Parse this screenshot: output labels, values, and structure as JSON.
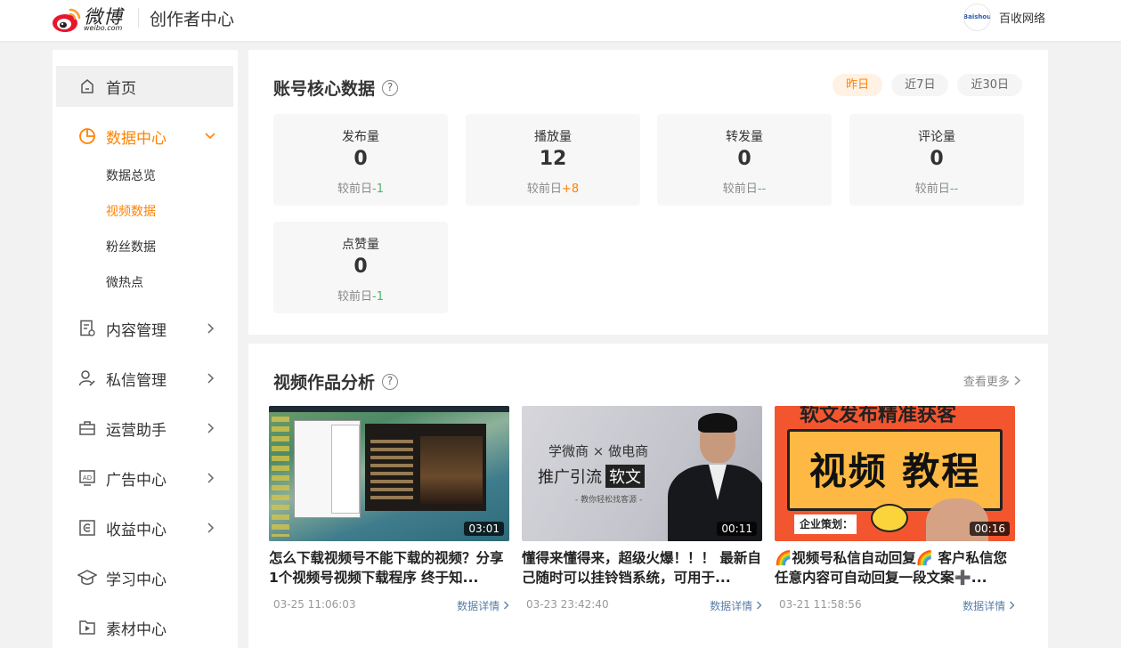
{
  "header": {
    "logo_word": "微博",
    "logo_url": "weibo.com",
    "title": "创作者中心",
    "user_name": "百收网络",
    "user_avatar_text": "Baishou"
  },
  "sidebar": {
    "items": [
      {
        "label": "首页",
        "icon": "home-icon"
      },
      {
        "label": "数据中心",
        "icon": "pie-chart-icon"
      },
      {
        "label": "内容管理",
        "icon": "document-icon"
      },
      {
        "label": "私信管理",
        "icon": "user-edit-icon"
      },
      {
        "label": "运营助手",
        "icon": "briefcase-icon"
      },
      {
        "label": "广告中心",
        "icon": "ad-icon"
      },
      {
        "label": "收益中心",
        "icon": "income-icon"
      },
      {
        "label": "学习中心",
        "icon": "graduation-cap-icon"
      },
      {
        "label": "素材中心",
        "icon": "media-folder-icon"
      }
    ],
    "sub_items": [
      "数据总览",
      "视频数据",
      "粉丝数据",
      "微热点"
    ]
  },
  "core": {
    "title": "账号核心数据",
    "help": "?",
    "ranges": [
      "昨日",
      "近7日",
      "近30日"
    ],
    "compare_label": "较前日",
    "stats": [
      {
        "label": "发布量",
        "value": "0",
        "delta": "-1"
      },
      {
        "label": "播放量",
        "value": "12",
        "delta": "+8"
      },
      {
        "label": "转发量",
        "value": "0",
        "delta": "--"
      },
      {
        "label": "评论量",
        "value": "0",
        "delta": "--"
      },
      {
        "label": "点赞量",
        "value": "0",
        "delta": "-1"
      }
    ]
  },
  "videos": {
    "title": "视频作品分析",
    "help": "?",
    "more": "查看更多",
    "detail_label": "数据详情",
    "items": [
      {
        "duration": "03:01",
        "title": "怎么下载视频号不能下载的视频？分享1个视频号视频下载程序 终于知...",
        "date": "03-25 11:06:03"
      },
      {
        "duration": "00:11",
        "title": "懂得来懂得来，超级火爆！！！ 最新自己随时可以挂铃铛系统，可用于...",
        "date": "03-23 23:42:40"
      },
      {
        "duration": "00:16",
        "title": "🌈视频号私信自动回复🌈 客户私信您任意内容可自动回复一段文案➕...",
        "date": "03-21 11:58:56"
      }
    ],
    "thumb2": {
      "line1": "学微商 × 做电商",
      "line2": "推广引流",
      "line2_box": "软文",
      "line3": "- 教你轻松找客源 -"
    },
    "thumb3": {
      "top": "软文发布精准获客",
      "big": "视频 教程",
      "bar": "企业策划："
    }
  },
  "colors": {
    "accent": "#ff8200",
    "down": "#4ab866",
    "link": "#5b7ea8"
  }
}
